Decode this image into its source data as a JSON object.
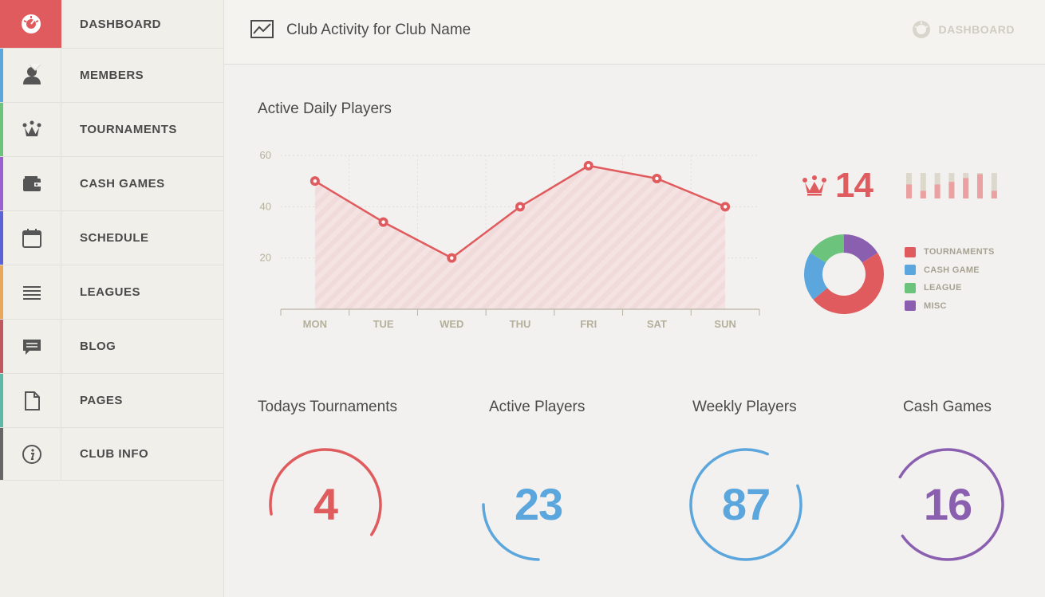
{
  "sidebar": {
    "items": [
      {
        "label": "DASHBOARD",
        "icon": "speedometer-icon",
        "color": "#e05b5e",
        "active": true
      },
      {
        "label": "MEMBERS",
        "icon": "user-icon",
        "color": "#5aa6dd"
      },
      {
        "label": "TOURNAMENTS",
        "icon": "crown-icon",
        "color": "#6cc37c"
      },
      {
        "label": "CASH GAMES",
        "icon": "wallet-icon",
        "color": "#9a5fd0"
      },
      {
        "label": "SCHEDULE",
        "icon": "calendar-icon",
        "color": "#5b62d8"
      },
      {
        "label": "LEAGUES",
        "icon": "list-icon",
        "color": "#e8a85a"
      },
      {
        "label": "BLOG",
        "icon": "chat-icon",
        "color": "#c0585e"
      },
      {
        "label": "PAGES",
        "icon": "document-icon",
        "color": "#5cb8a7"
      },
      {
        "label": "CLUB INFO",
        "icon": "info-icon",
        "color": "#666666"
      }
    ]
  },
  "header": {
    "title": "Club Activity for Club Name",
    "breadcrumb": "DASHBOARD"
  },
  "chart_section": {
    "title": "Active Daily Players"
  },
  "chart_data": {
    "type": "line",
    "title": "Active Daily Players",
    "categories": [
      "MON",
      "TUE",
      "WED",
      "THU",
      "FRI",
      "SAT",
      "SUN"
    ],
    "values": [
      50,
      34,
      20,
      40,
      56,
      51,
      40
    ],
    "y_ticks": [
      "20",
      "40",
      "60"
    ],
    "ylim": [
      0,
      60
    ],
    "grid": true,
    "color": "#e05b5e"
  },
  "tournament_stat": {
    "value": "14",
    "icon": "crown-icon"
  },
  "mini_bars": {
    "levels": [
      0.55,
      0.3,
      0.55,
      0.65,
      0.8,
      0.95,
      0.3
    ]
  },
  "donut": {
    "segments": [
      {
        "label": "TOURNAMENTS",
        "value": 48,
        "color": "#e05b5e"
      },
      {
        "label": "CASH GAME",
        "value": 20,
        "color": "#5aa6dd"
      },
      {
        "label": "LEAGUE",
        "value": 16,
        "color": "#6cc37c"
      },
      {
        "label": "MISC",
        "value": 16,
        "color": "#8a5fb0"
      }
    ]
  },
  "kpis": [
    {
      "title": "Todays Tournaments",
      "value": "4",
      "color": "#e05b5e",
      "fraction": 0.62
    },
    {
      "title": "Active Players",
      "value": "23",
      "color": "#5aa6dd",
      "fraction": 0.25
    },
    {
      "title": "Weekly Players",
      "value": "87",
      "color": "#5aa6dd",
      "fraction": 0.87
    },
    {
      "title": "Cash Games",
      "value": "16",
      "color": "#8a5fb0",
      "fraction": 0.82
    }
  ]
}
